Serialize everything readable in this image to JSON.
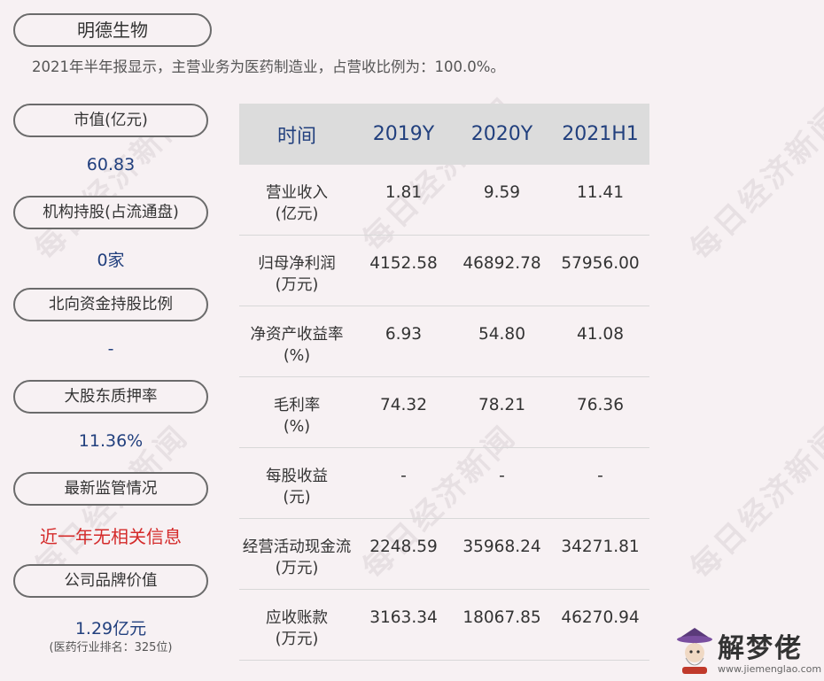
{
  "company": "明德生物",
  "summary": "2021年半年报显示，主营业务为医药制造业，占营收比例为：100.0%。",
  "watermark": "每日经济新闻",
  "metrics": [
    {
      "label": "市值(亿元)",
      "value": "60.83"
    },
    {
      "label": "机构持股(占流通盘)",
      "value": "0家"
    },
    {
      "label": "北向资金持股比例",
      "value": "-"
    },
    {
      "label": "大股东质押率",
      "value": "11.36%"
    },
    {
      "label": "最新监管情况",
      "value": "近一年无相关信息"
    },
    {
      "label": "公司品牌价值",
      "value": "1.29亿元",
      "note": "(医药行业排名：325位)"
    }
  ],
  "table": {
    "headers": [
      "时间",
      "2019Y",
      "2020Y",
      "2021H1"
    ],
    "rows": [
      {
        "label": "营业收入",
        "unit": "(亿元)",
        "values": [
          "1.81",
          "9.59",
          "11.41"
        ]
      },
      {
        "label": "归母净利润",
        "unit": "(万元)",
        "values": [
          "4152.58",
          "46892.78",
          "57956.00"
        ]
      },
      {
        "label": "净资产收益率",
        "unit": "(%)",
        "values": [
          "6.93",
          "54.80",
          "41.08"
        ]
      },
      {
        "label": "毛利率",
        "unit": "(%)",
        "values": [
          "74.32",
          "78.21",
          "76.36"
        ]
      },
      {
        "label": "每股收益",
        "unit": "(元)",
        "values": [
          "-",
          "-",
          "-"
        ]
      },
      {
        "label": "经营活动现金流",
        "unit": "(万元)",
        "values": [
          "2248.59",
          "35968.24",
          "34271.81"
        ]
      },
      {
        "label": "应收账款",
        "unit": "(万元)",
        "values": [
          "3163.34",
          "18067.85",
          "46270.94"
        ]
      }
    ]
  },
  "logo": {
    "text": "解梦佬",
    "url": "www.jiemenglao.com"
  },
  "colors": {
    "accent": "#22407e",
    "alert": "#d42a2a",
    "header_bg": "#dcdcdc",
    "background": "#f7f1f3"
  }
}
